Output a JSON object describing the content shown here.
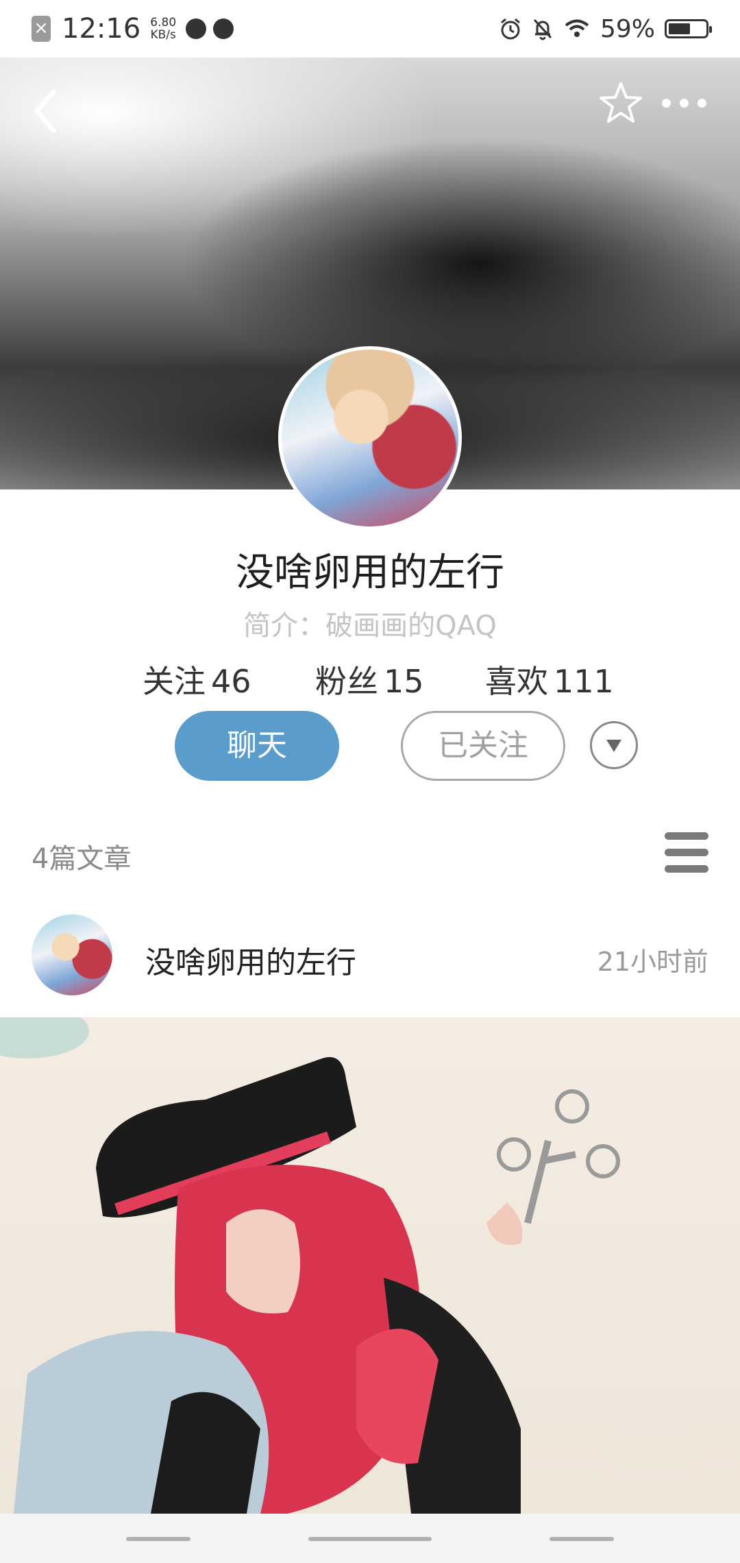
{
  "status_bar": {
    "time": "12:16",
    "speed_value": "6.80",
    "speed_unit": "KB/s",
    "battery_percent": "59%",
    "battery_level": 0.59,
    "icons": [
      "sim-off-icon",
      "app-notification-icon",
      "app-notification-icon",
      "alarm-icon",
      "bell-muted-icon",
      "wifi-icon",
      "battery-icon"
    ]
  },
  "header": {
    "icons": [
      "back-icon",
      "star-icon",
      "more-icon"
    ]
  },
  "profile": {
    "name": "没啥卵用的左行",
    "intro": "简介：破画画的QAQ",
    "stats": [
      {
        "label": "关注",
        "value": "46"
      },
      {
        "label": "粉丝",
        "value": "15"
      },
      {
        "label": "喜欢",
        "value": "111"
      }
    ],
    "chat_label": "聊天",
    "followed_label": "已关注"
  },
  "articles": {
    "count_label": "4篇文章",
    "items": [
      {
        "author": "没啥卵用的左行",
        "time": "21小时前"
      }
    ]
  },
  "colors": {
    "accent": "#5a9dcc",
    "muted_text": "#c4c4c4"
  }
}
